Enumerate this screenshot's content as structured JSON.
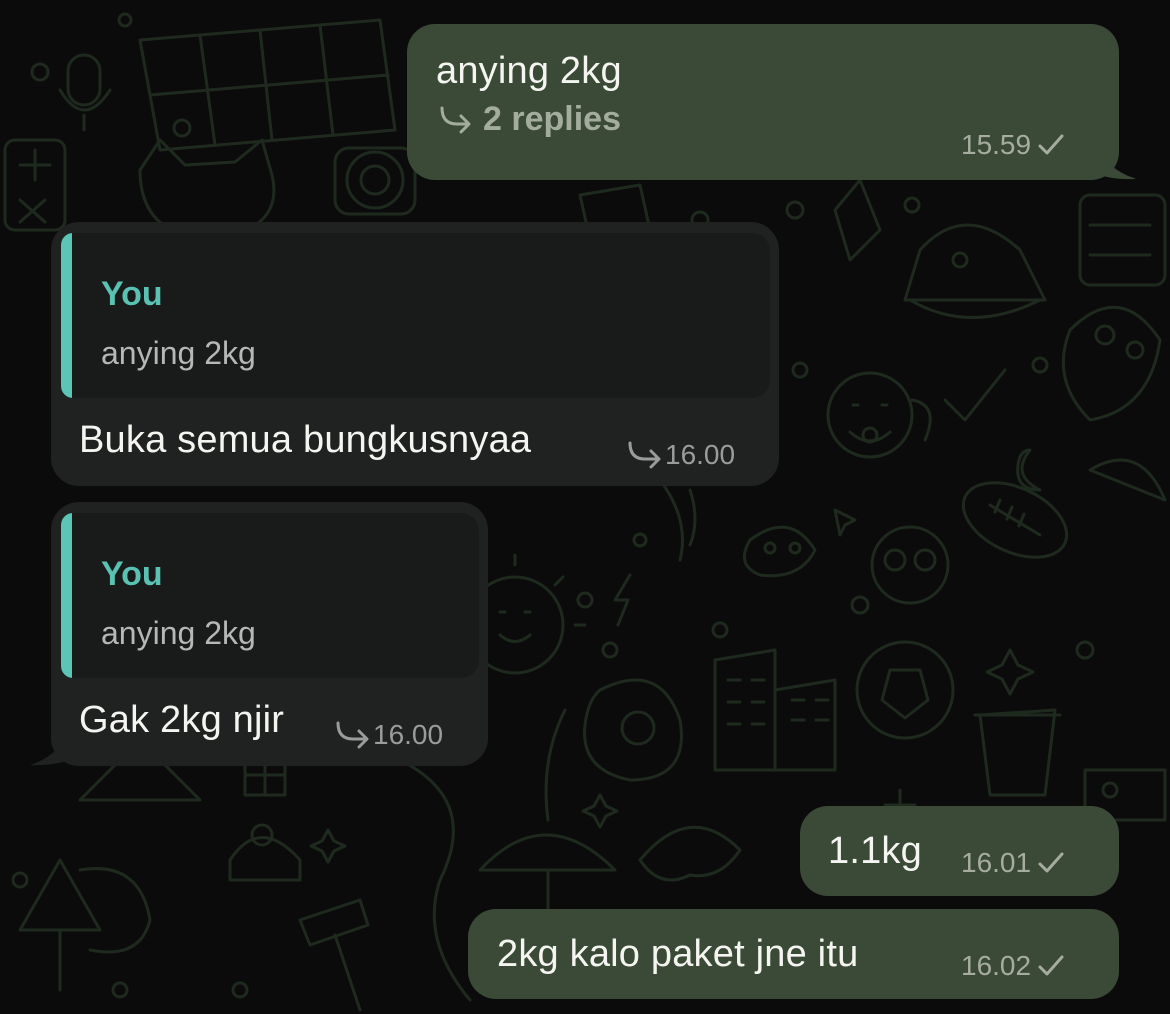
{
  "theme": {
    "background": "#0b0b0b",
    "outgoing_bubble": "#3a4a36",
    "incoming_bubble": "#202222",
    "quote_accent": "#5bc6b3",
    "quote_background": "#191a1a"
  },
  "messages": [
    {
      "direction": "outgoing",
      "text": "anying 2kg",
      "replies": "2 replies",
      "replies_icon": "reply-arrow-icon",
      "time": "15.59",
      "status_icon": "check-icon"
    },
    {
      "direction": "incoming",
      "quote": {
        "author": "You",
        "text": "anying 2kg"
      },
      "text": "Buka semua bungkusnyaa",
      "reply_icon": "reply-arrow-icon",
      "time": "16.00"
    },
    {
      "direction": "incoming",
      "quote": {
        "author": "You",
        "text": "anying 2kg"
      },
      "text": "Gak 2kg njir",
      "reply_icon": "reply-arrow-icon",
      "time": "16.00"
    },
    {
      "direction": "outgoing",
      "text": "1.1kg",
      "time": "16.01",
      "status_icon": "check-icon"
    },
    {
      "direction": "outgoing",
      "text": "2kg kalo paket jne itu",
      "time": "16.02",
      "status_icon": "check-icon"
    }
  ]
}
